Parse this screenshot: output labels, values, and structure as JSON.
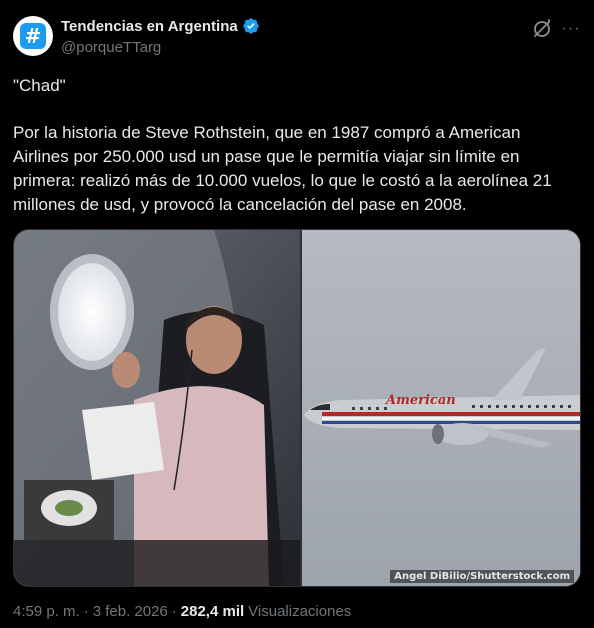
{
  "author": {
    "display_name": "Tendencias en Argentina",
    "handle": "@porqueTTarg",
    "avatar_symbol": "#",
    "verified": true,
    "avatar_color": "#1d9bf0"
  },
  "header_actions": {
    "grok_icon": "grok-icon",
    "more_label": "···"
  },
  "tweet": {
    "quote": "\"Chad\"",
    "text": "Por la historia de Steve Rothstein, que en 1987 compró a American Airlines por 250.000 usd un pase que le permitía viajar sin límite en primera: realizó más de 10.000 vuelos, lo que le costó a la aerolínea 21 millones de usd, y provocó la cancelación del pase en 2008."
  },
  "media": {
    "left_image": "man-in-airplane-seat-holding-paper",
    "right_image": "american-airlines-plane-in-flight",
    "plane_livery_text": "American",
    "watermark": "Angel DiBilio/Shutterstock.com"
  },
  "footer": {
    "time": "4:59 p. m.",
    "separator1": "·",
    "date": "3 feb. 2026",
    "separator2": "·",
    "views_count": "282,4 mil",
    "views_label": "Visualizaciones"
  },
  "colors": {
    "background": "#000000",
    "text_primary": "#e7e9ea",
    "text_secondary": "#71767b",
    "accent": "#1d9bf0"
  }
}
